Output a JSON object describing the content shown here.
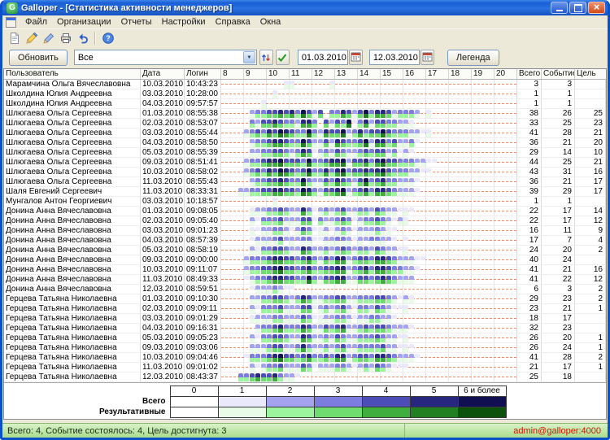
{
  "window": {
    "title": "Galloper - [Статистика активности менеджеров]"
  },
  "menu": {
    "items": [
      "Файл",
      "Организации",
      "Отчеты",
      "Настройки",
      "Справка",
      "Окна"
    ]
  },
  "toolbar": {
    "icons": [
      "new-document-icon",
      "edit-pencil-icon",
      "edit-pen-icon",
      "printer-icon",
      "undo-arrow-icon",
      "separator",
      "help-icon"
    ]
  },
  "filters": {
    "refresh_label": "Обновить",
    "manager_filter_value": "Все",
    "extra_buttons": [
      "sort-arrows-icon",
      "confirm-check-icon"
    ],
    "date_from": "01.03.2010",
    "date_to": "12.03.2010",
    "legend_label": "Легенда",
    "icons": [
      "calendar-icon",
      "chevron-down-icon"
    ]
  },
  "table": {
    "columns": {
      "user": "Пользователь",
      "date": "Дата",
      "login": "Логин",
      "total": "Всего",
      "event": "Событие",
      "goal": "Цель"
    },
    "hours": [
      "8",
      "9",
      "10",
      "11",
      "12",
      "13",
      "14",
      "15",
      "16",
      "17",
      "18",
      "19",
      "20"
    ],
    "rows": [
      {
        "user": "Марамчина Ольга Вячеславовна",
        "date": "10.03.2010",
        "login": "10:43:23",
        "total": "3",
        "event": "3",
        "goal": "",
        "t": "0000000000011000000100000000000000000000000000000000",
        "r": "0000000000011000000100000000000000000000000000000000"
      },
      {
        "user": "Школдина Юлия Андреевна",
        "date": "03.03.2010",
        "login": "10:28:00",
        "total": "1",
        "event": "1",
        "goal": "",
        "t": "0000000001000000000000000000000000000000000000000000",
        "r": "0000000001000000000000000000000000000000000000000000"
      },
      {
        "user": "Школдина Юлия Андреевна",
        "date": "04.03.2010",
        "login": "09:57:57",
        "total": "1",
        "event": "1",
        "goal": "",
        "t": "0000000100000000000000000000000000000000000000000000",
        "r": "0000000100000000000000000000000000000000000000000000"
      },
      {
        "user": "Шлюгаева Ольга Сергеевна",
        "date": "01.03.2010",
        "login": "08:55:38",
        "total": "38",
        "event": "26",
        "goal": "25",
        "t": "0000023344545364240335424635542333201000000000000000",
        "r": "0000012233434253130224313524431222101000000000000000"
      },
      {
        "user": "Шлюгаева Ольга Сергеевна",
        "date": "02.03.2010",
        "login": "08:53:07",
        "total": "33",
        "event": "25",
        "goal": "23",
        "t": "0000032445433255304243613524433221000000000000000000",
        "r": "0000021334322144203132502413322111000000000000000000"
      },
      {
        "user": "Шлюгаева Ольга Сергеевна",
        "date": "03.03.2010",
        "login": "08:55:44",
        "total": "41",
        "event": "28",
        "goal": "21",
        "t": "0000234354654336325446235344643332211000000000000000",
        "r": "0000123243543225214335124233532221101000000000000000"
      },
      {
        "user": "Шлюгаева Ольга Сергеевна",
        "date": "04.03.2010",
        "login": "08:58:50",
        "total": "36",
        "event": "21",
        "goal": "20",
        "t": "0000023345543364224254334625534223100000000000000000",
        "r": "0000012234432253113143223514423112000000000000000000"
      },
      {
        "user": "Шлюгаева Ольга Сергеевна",
        "date": "05.03.2010",
        "login": "08:55:39",
        "total": "29",
        "event": "14",
        "goal": "10",
        "t": "0000022334432354123243223434423121000000000000000000",
        "r": "0000011223321243012132112323312010000000000000000000"
      },
      {
        "user": "Шлюгаева Ольга Сергеевна",
        "date": "09.03.2010",
        "login": "08:51:41",
        "total": "44",
        "event": "25",
        "goal": "21",
        "t": "0000233455644436334556244535644333221100000000000000",
        "r": "0000122344533325223445133424533222110000000000000000"
      },
      {
        "user": "Шлюгаева Ольга Сергеевна",
        "date": "10.03.2010",
        "login": "08:58:02",
        "total": "43",
        "event": "31",
        "goal": "16",
        "t": "0000234354654346335356344545643332211000000000000000",
        "r": "0000123243543235224245233434532221100000000000000000"
      },
      {
        "user": "Шлюгаева Ольга Сергеевна",
        "date": "11.03.2010",
        "login": "08:55:43",
        "total": "36",
        "event": "21",
        "goal": "17",
        "t": "0000023344543363224354324634533222100000000000000000",
        "r": "0000012233432252113243213523422111000000000000000000"
      },
      {
        "user": "Шаля Евгений Сергеевич",
        "date": "11.03.2010",
        "login": "08:33:31",
        "total": "39",
        "event": "29",
        "goal": "17",
        "t": "0002233445544365324456234535543222100000000000000000",
        "r": "0001122334433254213345123424432111000000000000000000"
      },
      {
        "user": "Мунгалов Антон Георгиевич",
        "date": "03.03.2010",
        "login": "10:18:57",
        "total": "1",
        "event": "1",
        "goal": "",
        "t": "0000000001000000000000000000000000000000000000000000",
        "r": "0000000001000000000000000000000000000000000000000000"
      },
      {
        "user": "Донина Анна Вячеславовна",
        "date": "01.03.2010",
        "login": "09:08:05",
        "total": "22",
        "event": "17",
        "goal": "14",
        "t": "0000012233432253123234223324322111000000000000000000",
        "r": "0000011122321142012123112213211010000000000000000000"
      },
      {
        "user": "Донина Анна Вячеславовна",
        "date": "02.03.2010",
        "login": "09:05:40",
        "total": "22",
        "event": "17",
        "goal": "12",
        "t": "0000021333422244132234312334321210000000000000000000",
        "r": "0000010222311133021123201223210110000000000000000000"
      },
      {
        "user": "Донина Анна Вячеславовна",
        "date": "03.03.2010",
        "login": "09:01:23",
        "total": "16",
        "event": "11",
        "goal": "9",
        "t": "0000011223321243112123212223211000000000000000000000",
        "r": "0000010112210132011012101112110000000000000000000000"
      },
      {
        "user": "Донина Анна Вячеславовна",
        "date": "04.03.2010",
        "login": "08:57:39",
        "total": "17",
        "event": "7",
        "goal": "4",
        "t": "0000012223422233112233212233221010000000000000000000",
        "r": "0000001111201011001111101011100000000000000000000000"
      },
      {
        "user": "Донина Анна Вячеславовна",
        "date": "05.03.2010",
        "login": "08:58:19",
        "total": "24",
        "event": "20",
        "goal": "2",
        "t": "0000021334432254223234323324322110000000000000000000",
        "r": "0000011223321143112123212213211010000000000000000000"
      },
      {
        "user": "Донина Анна Вячеславовна",
        "date": "09.03.2010",
        "login": "09:00:00",
        "total": "40",
        "event": "24",
        "goal": "",
        "t": "0000233345544345324355234435543222110000000000000000",
        "r": "0000122234433234213244123324432111000000000000000000"
      },
      {
        "user": "Донина Анна Вячеславовна",
        "date": "10.03.2010",
        "login": "09:11:07",
        "total": "41",
        "event": "21",
        "goal": "16",
        "t": "0000233445644345334455234535543322100000000000000000",
        "r": "0000122334533234223344123424432211000000000000000000"
      },
      {
        "user": "Донина Анна Вячеславовна",
        "date": "11.03.2010",
        "login": "08:49:33",
        "total": "41",
        "event": "22",
        "goal": "12",
        "t": "0000123345544336324455224434543222000000000000000000",
        "r": "0000012234433225213344113323432111000000000000000000"
      },
      {
        "user": "Донина Анна Вячеславовна",
        "date": "12.03.2010",
        "login": "08:59:51",
        "total": "6",
        "event": "3",
        "goal": "2",
        "t": "0000012223211000000000000000000000000000000000000000",
        "r": "0000001112100000000000000000000000000000000000000000"
      },
      {
        "user": "Герцева Татьяна Николаевна",
        "date": "01.03.2010",
        "login": "09:10:30",
        "total": "29",
        "event": "23",
        "goal": "2",
        "t": "0000022334432354223344223334432121000000000000000000",
        "r": "0000011223321243112233112223321011000000000000000000"
      },
      {
        "user": "Герцева Татьяна Николаевна",
        "date": "02.03.2010",
        "login": "09:09:11",
        "total": "23",
        "event": "21",
        "goal": "1",
        "t": "0000021333422244123234213324321110000000000000000000",
        "r": "0000010222311133012123102213210010000000000000000000"
      },
      {
        "user": "Герцева Татьяна Николаевна",
        "date": "03.03.2010",
        "login": "09:01:29",
        "total": "18",
        "event": "17",
        "goal": "",
        "t": "0000012223322243112233212233221000000000000000000000",
        "r": "0000011112211132011122101122110000000000000000000000"
      },
      {
        "user": "Герцева Татьяна Николаевна",
        "date": "04.03.2010",
        "login": "09:16:31",
        "total": "32",
        "event": "23",
        "goal": "",
        "t": "0000002334533354224345223434432221000000000000000000",
        "r": "0000001223422243113234112323321110000000000000000000"
      },
      {
        "user": "Герцева Татьяна Николаевна",
        "date": "05.03.2010",
        "login": "09:05:23",
        "total": "26",
        "event": "20",
        "goal": "1",
        "t": "0000021334432254223243223334322110000000000000000000",
        "r": "0000010223321143112132112223211010000000000000000000"
      },
      {
        "user": "Герцева Татьяна Николаевна",
        "date": "09.03.2010",
        "login": "09:03:06",
        "total": "26",
        "event": "24",
        "goal": "1",
        "t": "0000022234422353223234223333422111000000000000000000",
        "r": "0000011123311242112123112222311010000000000000000000"
      },
      {
        "user": "Герцева Татьяна Николаевна",
        "date": "10.03.2010",
        "login": "09:04:46",
        "total": "41",
        "event": "28",
        "goal": "2",
        "t": "0000133345644345334355234435543222100000000000000000",
        "r": "0000022234533234223244123324432111000000000000000000"
      },
      {
        "user": "Герцева Татьяна Николаевна",
        "date": "11.03.2010",
        "login": "09:01:02",
        "total": "21",
        "event": "17",
        "goal": "1",
        "t": "0000021233422243122233212324321110000000000000000000",
        "r": "0000010122311132011122101213210000000000000000000000"
      },
      {
        "user": "Герцева Татьяна Николаевна",
        "date": "12.03.2010",
        "login": "08:43:37",
        "total": "25",
        "event": "18",
        "goal": "",
        "t": "0003345445322100000000000000000000000000000000000000",
        "r": "0002234334211000000000000000000000000000000000000000"
      }
    ]
  },
  "legend": {
    "headers": [
      "0",
      "1",
      "2",
      "3",
      "4",
      "5",
      "6 и более"
    ],
    "rows": [
      {
        "label": "Всего",
        "colors": [
          "#ffffff",
          "#e9e9fb",
          "#a3a3f0",
          "#7d7ddf",
          "#4d4db8",
          "#27277f",
          "#0f0f52"
        ]
      },
      {
        "label": "Результативные",
        "colors": [
          "#ffffff",
          "#e7fbe7",
          "#9cf59c",
          "#6fdc6f",
          "#3fae3f",
          "#228022",
          "#0c520c"
        ]
      }
    ]
  },
  "statusbar": {
    "left": "Всего: 4, Событие состоялось: 4, Цель достигнута: 3",
    "right": "admin@galloper:4000"
  }
}
